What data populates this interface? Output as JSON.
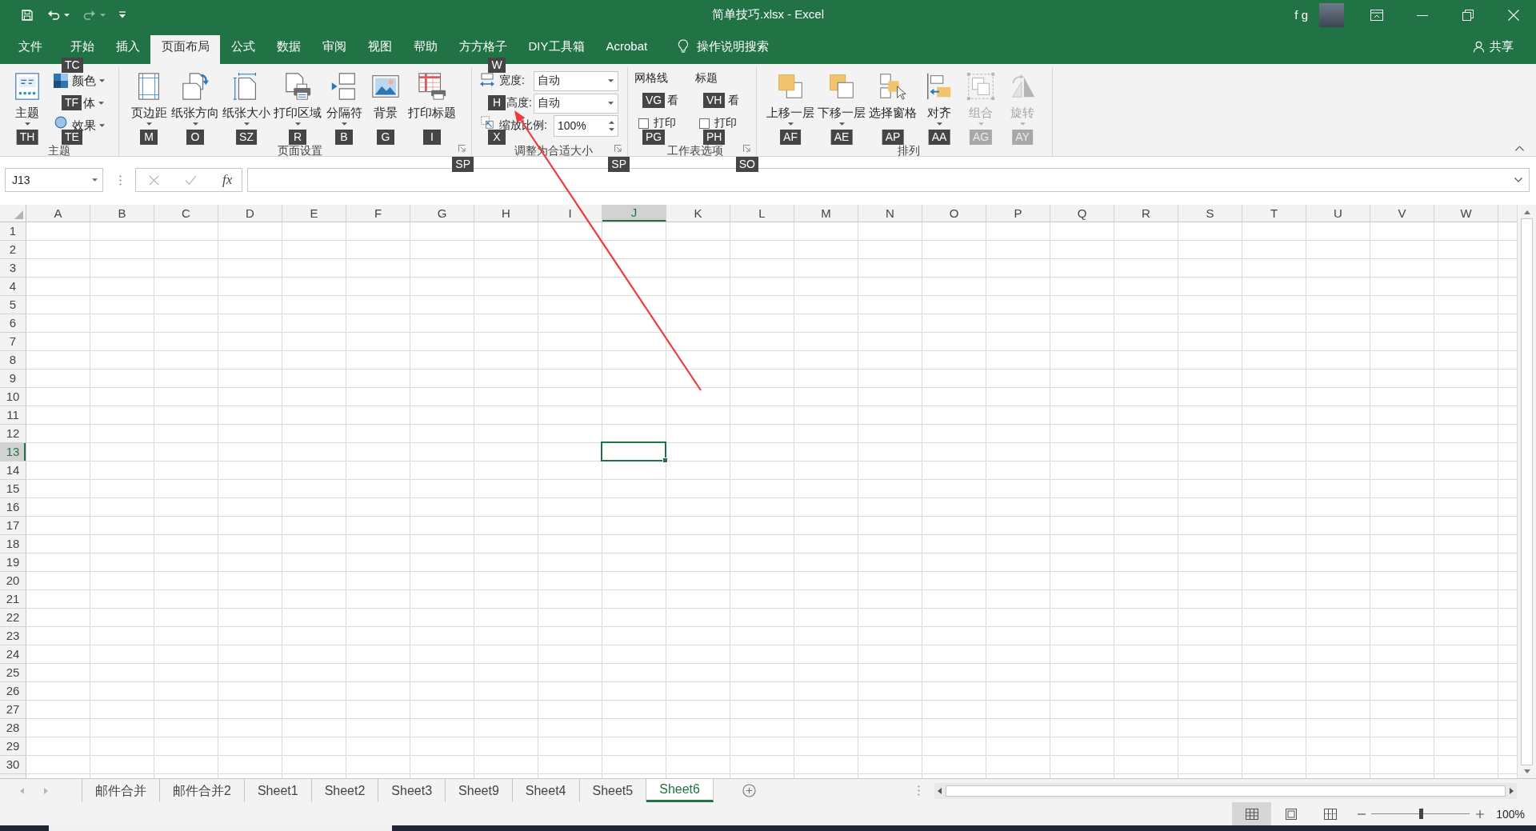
{
  "quick_access": [
    {
      "kind": "save",
      "disabled": false
    },
    {
      "kind": "undo",
      "disabled": false
    },
    {
      "kind": "redo",
      "disabled": true
    },
    {
      "kind": "customize",
      "disabled": false
    }
  ],
  "window": {
    "title": "简单技巧.xlsx - Excel",
    "user": "f g"
  },
  "tabs": [
    {
      "label": "文件",
      "selected": false
    },
    {
      "label": "开始",
      "selected": false
    },
    {
      "label": "插入",
      "selected": false
    },
    {
      "label": "页面布局",
      "selected": true
    },
    {
      "label": "公式",
      "selected": false
    },
    {
      "label": "数据",
      "selected": false
    },
    {
      "label": "审阅",
      "selected": false
    },
    {
      "label": "视图",
      "selected": false
    },
    {
      "label": "帮助",
      "selected": false
    },
    {
      "label": "方方格子",
      "selected": false
    },
    {
      "label": "DIY工具箱",
      "selected": false
    },
    {
      "label": "Acrobat",
      "selected": false
    }
  ],
  "tell_me": {
    "label": "操作说明搜索"
  },
  "share": {
    "label": "共享"
  },
  "ribbon": {
    "groups": [
      {
        "label": "主题",
        "items": [
          {
            "kind": "large",
            "label": "主题",
            "key_tip": "TH",
            "dropdown": true
          },
          {
            "kind": "small",
            "label": "颜色",
            "key_tip": "TC",
            "dropdown": true
          },
          {
            "kind": "small",
            "label": "体",
            "key_tip": "TF",
            "dropdown": true
          },
          {
            "kind": "small",
            "label": "效果",
            "key_tip": "TE",
            "dropdown": true
          }
        ]
      },
      {
        "label": "页面设置",
        "launcher": {
          "key_tip": "SP"
        },
        "items": [
          {
            "kind": "large",
            "label": "页边距",
            "key_tip": "M",
            "dropdown": true
          },
          {
            "kind": "large",
            "label": "纸张方向",
            "key_tip": "O",
            "dropdown": true
          },
          {
            "kind": "large",
            "label": "纸张大小",
            "key_tip": "SZ",
            "dropdown": true
          },
          {
            "kind": "large",
            "label": "打印区域",
            "key_tip": "R",
            "dropdown": true
          },
          {
            "kind": "large",
            "label": "分隔符",
            "key_tip": "B",
            "dropdown": true
          },
          {
            "kind": "large",
            "label": "背景",
            "key_tip": "G",
            "dropdown": false
          },
          {
            "kind": "large",
            "label": "打印标题",
            "key_tip": "I",
            "dropdown": false
          }
        ]
      },
      {
        "label": "调整为合适大小",
        "launcher": {
          "key_tip": "SP"
        },
        "items": [
          {
            "kind": "select",
            "label": "宽度:",
            "value": "自动",
            "key_tip": "W"
          },
          {
            "kind": "select",
            "label": "高度:",
            "value": "自动",
            "key_tip": "H"
          },
          {
            "kind": "spin",
            "label": "缩放比例:",
            "value": "100%",
            "key_tip": "X"
          }
        ]
      },
      {
        "label": "工作表选项",
        "launcher": {
          "key_tip": "SO"
        },
        "items": [
          {
            "kind": "options",
            "heading": "网格线",
            "options": [
              {
                "label": "看",
                "key_tip": "VG"
              },
              {
                "label": "打印",
                "key_tip": "PG",
                "checked": false
              }
            ]
          },
          {
            "kind": "options",
            "heading": "标题",
            "options": [
              {
                "label": "看",
                "key_tip": "VH"
              },
              {
                "label": "打印",
                "key_tip": "PH",
                "checked": false
              }
            ]
          }
        ]
      },
      {
        "label": "排列",
        "items": [
          {
            "kind": "large",
            "label": "上移一层",
            "key_tip": "AF",
            "dropdown": true,
            "disabled": false
          },
          {
            "kind": "large",
            "label": "下移一层",
            "key_tip": "AE",
            "dropdown": true,
            "disabled": false
          },
          {
            "kind": "large",
            "label": "选择窗格",
            "key_tip": "AP",
            "dropdown": false,
            "disabled": false
          },
          {
            "kind": "large",
            "label": "对齐",
            "key_tip": "AA",
            "dropdown": true,
            "disabled": false
          },
          {
            "kind": "large",
            "label": "组合",
            "key_tip": "AG",
            "dropdown": true,
            "disabled": true
          },
          {
            "kind": "large",
            "label": "旋转",
            "key_tip": "AY",
            "dropdown": true,
            "disabled": true
          }
        ]
      }
    ]
  },
  "formula_bar": {
    "name_box": "J13",
    "buttons": [
      {
        "kind": "cancel",
        "disabled": true
      },
      {
        "kind": "enter",
        "disabled": true
      },
      {
        "kind": "function",
        "label": "fx",
        "disabled": false
      }
    ]
  },
  "sheet": {
    "columns": [
      {
        "label": "A",
        "selected": false
      },
      {
        "label": "B",
        "selected": false
      },
      {
        "label": "C",
        "selected": false
      },
      {
        "label": "D",
        "selected": false
      },
      {
        "label": "E",
        "selected": false
      },
      {
        "label": "F",
        "selected": false
      },
      {
        "label": "G",
        "selected": false
      },
      {
        "label": "H",
        "selected": false
      },
      {
        "label": "I",
        "selected": false
      },
      {
        "label": "J",
        "selected": true
      },
      {
        "label": "K",
        "selected": false
      },
      {
        "label": "L",
        "selected": false
      },
      {
        "label": "M",
        "selected": false
      },
      {
        "label": "N",
        "selected": false
      },
      {
        "label": "O",
        "selected": false
      },
      {
        "label": "P",
        "selected": false
      },
      {
        "label": "Q",
        "selected": false
      },
      {
        "label": "R",
        "selected": false
      },
      {
        "label": "S",
        "selected": false
      },
      {
        "label": "T",
        "selected": false
      },
      {
        "label": "U",
        "selected": false
      },
      {
        "label": "V",
        "selected": false
      },
      {
        "label": "W",
        "selected": false
      }
    ],
    "rows": [
      {
        "label": "1",
        "selected": false
      },
      {
        "label": "2",
        "selected": false
      },
      {
        "label": "3",
        "selected": false
      },
      {
        "label": "4",
        "selected": false
      },
      {
        "label": "5",
        "selected": false
      },
      {
        "label": "6",
        "selected": false
      },
      {
        "label": "7",
        "selected": false
      },
      {
        "label": "8",
        "selected": false
      },
      {
        "label": "9",
        "selected": false
      },
      {
        "label": "10",
        "selected": false
      },
      {
        "label": "11",
        "selected": false
      },
      {
        "label": "12",
        "selected": false
      },
      {
        "label": "13",
        "selected": true
      },
      {
        "label": "14",
        "selected": false
      },
      {
        "label": "15",
        "selected": false
      },
      {
        "label": "16",
        "selected": false
      },
      {
        "label": "17",
        "selected": false
      },
      {
        "label": "18",
        "selected": false
      },
      {
        "label": "19",
        "selected": false
      },
      {
        "label": "20",
        "selected": false
      },
      {
        "label": "21",
        "selected": false
      },
      {
        "label": "22",
        "selected": false
      },
      {
        "label": "23",
        "selected": false
      },
      {
        "label": "24",
        "selected": false
      },
      {
        "label": "25",
        "selected": false
      },
      {
        "label": "26",
        "selected": false
      },
      {
        "label": "27",
        "selected": false
      },
      {
        "label": "28",
        "selected": false
      },
      {
        "label": "29",
        "selected": false
      },
      {
        "label": "30",
        "selected": false
      }
    ]
  },
  "sheet_tabs": [
    {
      "label": "邮件合并",
      "selected": false
    },
    {
      "label": "邮件合并2",
      "selected": false
    },
    {
      "label": "Sheet1",
      "selected": false
    },
    {
      "label": "Sheet2",
      "selected": false
    },
    {
      "label": "Sheet3",
      "selected": false
    },
    {
      "label": "Sheet9",
      "selected": false
    },
    {
      "label": "Sheet4",
      "selected": false
    },
    {
      "label": "Sheet5",
      "selected": false
    },
    {
      "label": "Sheet6",
      "selected": true
    }
  ],
  "status_bar": {
    "views": [
      {
        "kind": "normal",
        "selected": true
      },
      {
        "kind": "page_layout",
        "selected": false
      },
      {
        "kind": "page_break",
        "selected": false
      }
    ],
    "zoom": {
      "level": 0.5,
      "reading": "100%"
    }
  }
}
